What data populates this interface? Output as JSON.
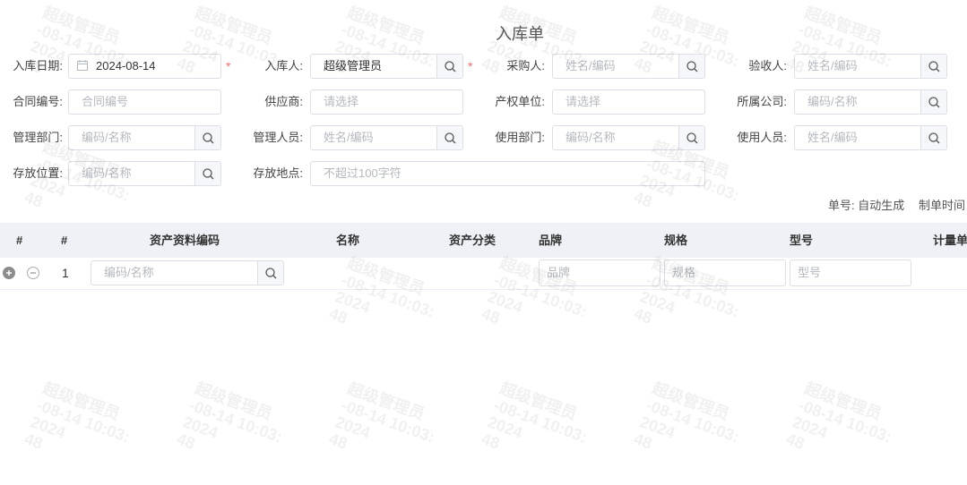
{
  "page": {
    "title": "入库单"
  },
  "form": {
    "inbound_date": {
      "label": "入库日期:",
      "value": "2024-08-14"
    },
    "inbound_person": {
      "label": "入库人:",
      "value": "超级管理员"
    },
    "purchaser": {
      "label": "采购人:",
      "placeholder": "姓名/编码"
    },
    "acceptor": {
      "label": "验收人:",
      "placeholder": "姓名/编码"
    },
    "contract_no": {
      "label": "合同编号:",
      "placeholder": "合同编号"
    },
    "supplier": {
      "label": "供应商:",
      "placeholder": "请选择"
    },
    "property_unit": {
      "label": "产权单位:",
      "placeholder": "请选择"
    },
    "company": {
      "label": "所属公司:",
      "placeholder": "编码/名称"
    },
    "mgmt_dept": {
      "label": "管理部门:",
      "placeholder": "编码/名称"
    },
    "mgmt_person": {
      "label": "管理人员:",
      "placeholder": "姓名/编码"
    },
    "use_dept": {
      "label": "使用部门:",
      "placeholder": "编码/名称"
    },
    "user": {
      "label": "使用人员:",
      "placeholder": "姓名/编码"
    },
    "location": {
      "label": "存放位置:",
      "placeholder": "编码/名称"
    },
    "address": {
      "label": "存放地点:",
      "placeholder": "不超过100字符"
    },
    "required_mark": "*"
  },
  "meta": {
    "doc_no": "单号: 自动生成",
    "created_time": "制单时间"
  },
  "table": {
    "headers": [
      "#",
      "#",
      "资产资料编码",
      "名称",
      "资产分类",
      "品牌",
      "规格",
      "型号",
      "计量单"
    ],
    "rows": [
      {
        "index": "1",
        "code_placeholder": "编码/名称",
        "brand_placeholder": "品牌",
        "spec_placeholder": "规格",
        "model_placeholder": "型号"
      }
    ]
  },
  "watermark": "超级管理员\n-08-14 10:03:\n2024\n48"
}
